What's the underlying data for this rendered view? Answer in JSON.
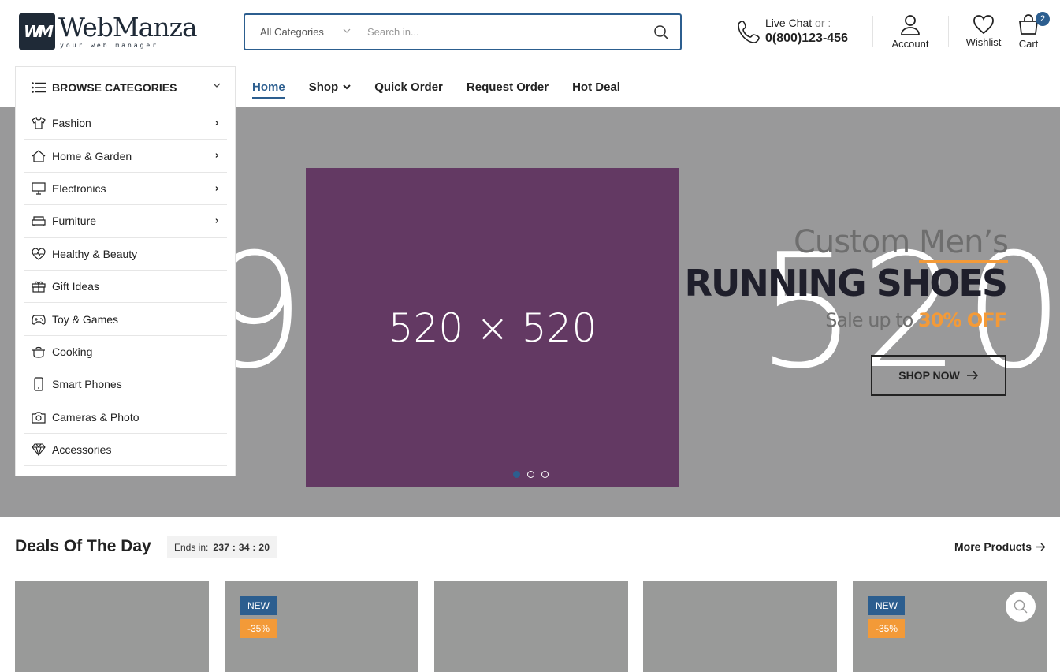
{
  "header": {
    "logo_text": "WebManza",
    "logo_tagline": "your web manager",
    "logo_mark": "WM",
    "search": {
      "category": "All Categories",
      "placeholder": "Search in..."
    },
    "contact": {
      "label": "Live Chat",
      "or": "or :",
      "phone": "0(800)123-456"
    },
    "account_label": "Account",
    "wishlist_label": "Wishlist",
    "cart_label": "Cart",
    "cart_count": "2"
  },
  "nav": {
    "browse_label": "BROWSE CATEGORIES",
    "menu": [
      {
        "label": "Home"
      },
      {
        "label": "Shop"
      },
      {
        "label": "Quick Order"
      },
      {
        "label": "Request Order"
      },
      {
        "label": "Hot Deal"
      }
    ]
  },
  "categories": [
    {
      "label": "Fashion",
      "icon": "tshirt-icon"
    },
    {
      "label": "Home & Garden",
      "icon": "home-icon"
    },
    {
      "label": "Electronics",
      "icon": "monitor-icon"
    },
    {
      "label": "Furniture",
      "icon": "sofa-icon"
    },
    {
      "label": "Healthy & Beauty",
      "icon": "heart-pulse-icon"
    },
    {
      "label": "Gift Ideas",
      "icon": "gift-icon"
    },
    {
      "label": "Toy & Games",
      "icon": "gamepad-icon"
    },
    {
      "label": "Cooking",
      "icon": "cooking-pot-icon"
    },
    {
      "label": "Smart Phones",
      "icon": "smartphone-icon"
    },
    {
      "label": "Cameras & Photo",
      "icon": "camera-icon"
    },
    {
      "label": "Accessories",
      "icon": "diamond-icon"
    }
  ],
  "hero": {
    "background_number": "920 × 520",
    "image_label": "520 × 520",
    "title_part1": "Custom",
    "title_part2": "Men’s",
    "title_main": "RUNNING SHOES",
    "sale_text": "Sale up to",
    "sale_value": "30% OFF",
    "button_label": "SHOP NOW",
    "slide_count": 3,
    "active_slide": 1
  },
  "deals": {
    "title": "Deals Of The Day",
    "ends_label": "Ends in:",
    "countdown": "237 : 34 : 20",
    "more_label": "More Products",
    "products": [
      {
        "new": "",
        "discount": ""
      },
      {
        "new": "NEW",
        "discount": "-35%"
      },
      {
        "new": "",
        "discount": ""
      },
      {
        "new": "",
        "discount": ""
      },
      {
        "new": "NEW",
        "discount": "-35%"
      }
    ]
  },
  "colors": {
    "primary": "#2c5e8f",
    "accent": "#f39a38",
    "dark": "#1f2a37",
    "hero_bg": "#99999a",
    "hero_image": "#633963"
  }
}
